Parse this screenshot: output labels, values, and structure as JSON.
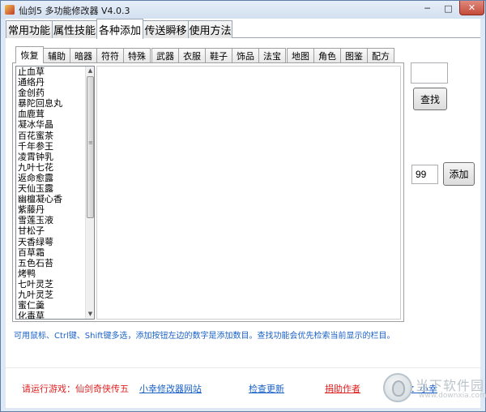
{
  "window": {
    "title": "仙剑5 多功能修改器  V4.0.3",
    "minimize_glyph": "─",
    "maximize_glyph": "□",
    "close_glyph": "✕"
  },
  "main_tabs": [
    {
      "label": "常用功能"
    },
    {
      "label": "属性技能"
    },
    {
      "label": "各种添加"
    },
    {
      "label": "传送瞬移"
    },
    {
      "label": "使用方法"
    }
  ],
  "active_main_tab": "各种添加",
  "sub_tabs": [
    {
      "label": "恢复"
    },
    {
      "label": "辅助"
    },
    {
      "label": "暗器"
    },
    {
      "label": "符符"
    },
    {
      "label": "特殊"
    },
    {
      "label": "武器"
    },
    {
      "label": "衣服"
    },
    {
      "label": "鞋子"
    },
    {
      "label": "饰品"
    },
    {
      "label": "法宝"
    },
    {
      "label": "地图"
    },
    {
      "label": "角色"
    },
    {
      "label": "图鉴"
    },
    {
      "label": "配方"
    }
  ],
  "active_sub_tab": "恢复",
  "items": [
    "止血草",
    "通络丹",
    "金创药",
    "暴陀回息丸",
    "血鹿茸",
    "凝冰华晶",
    "百花蜜茶",
    "千年参王",
    "凌霄钟乳",
    "九叶七花",
    "返命愈露",
    "天仙玉露",
    "幽檀凝心香",
    "紫藤丹",
    "雪莲玉液",
    "甘松子",
    "天香绿萼",
    "百草霜",
    "五色石苔",
    "烤鸭",
    "七叶灵芝",
    "九叶灵芝",
    "蜜仁羹",
    "化毒草"
  ],
  "search": {
    "value": "",
    "button_label": "查找"
  },
  "add": {
    "quantity": "99",
    "button_label": "添加"
  },
  "hint_text": "可用鼠标、Ctrl键、Shift键多选，添加按钮左边的数字是添加数目。查找功能会优先检索当前显示的栏目。",
  "footer": {
    "status": "请运行游戏：仙剑奇侠传五",
    "site_link": "小幸修改器网站",
    "update_link": "检查更新",
    "donate_link": "捐助作者",
    "author_link": "作者：小幸"
  },
  "watermark": {
    "name": "当下软件园",
    "url": "www.downxia.com"
  },
  "colors": {
    "accent_blue": "#1a62c8",
    "status_red": "#e02020",
    "frame": "#dfe9f5"
  }
}
